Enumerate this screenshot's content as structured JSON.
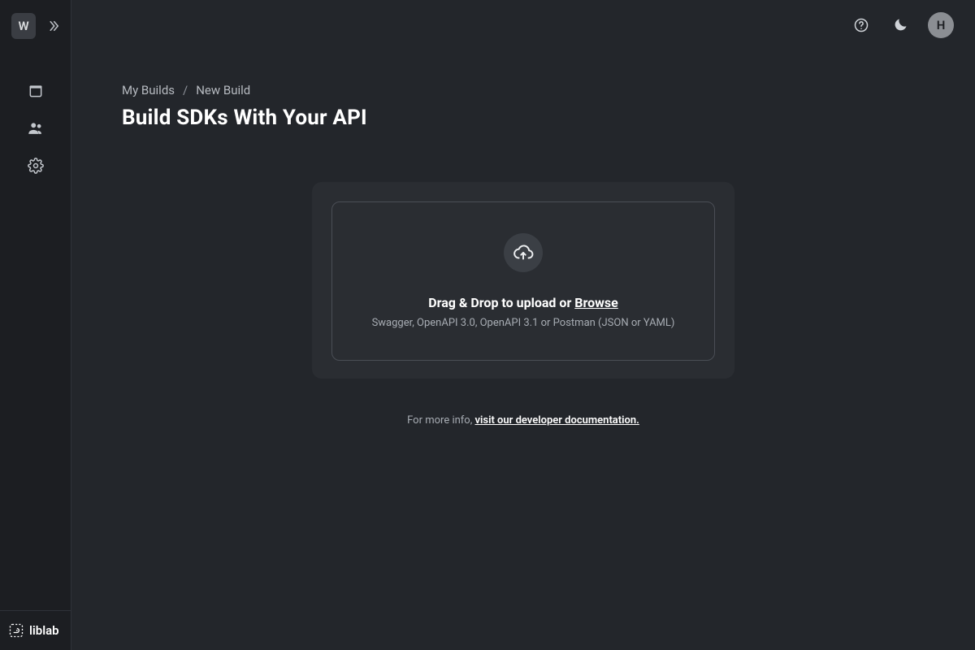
{
  "sidebar": {
    "workspace_initial": "W",
    "nav": {
      "builds": "builds-icon",
      "members": "members-icon",
      "settings": "settings-icon"
    },
    "brand": "liblab"
  },
  "topbar": {
    "avatar_initial": "H"
  },
  "breadcrumb": {
    "items": [
      "My Builds",
      "New Build"
    ],
    "separator": "/"
  },
  "page": {
    "title": "Build SDKs With Your API"
  },
  "upload": {
    "title_prefix": "Drag & Drop to upload or ",
    "browse_label": "Browse",
    "subtitle": "Swagger, OpenAPI 3.0, OpenAPI 3.1 or Postman (JSON or YAML)"
  },
  "info": {
    "prefix": "For more info, ",
    "link_text": "visit our developer documentation."
  }
}
